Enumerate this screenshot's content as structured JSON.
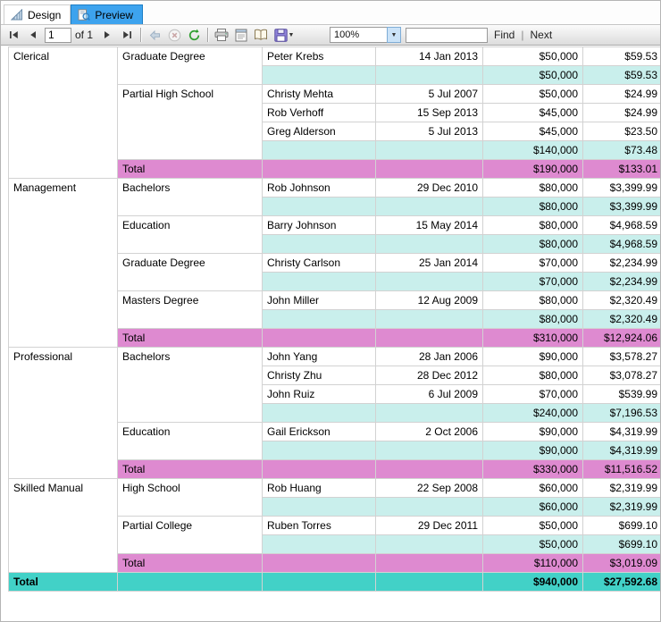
{
  "colors": {
    "active_tab": "#3da3ee",
    "subtotal_row": "#c9efec",
    "total_row": "#de8ad0",
    "grand_total_row": "#42d1c7"
  },
  "icons": {
    "chevron_down": "▼"
  },
  "tabs": {
    "design": {
      "label": "Design"
    },
    "preview": {
      "label": "Preview"
    }
  },
  "toolbar": {
    "page_value": "1",
    "of_label": "of 1",
    "zoom_value": "100%",
    "find_value": "",
    "find_label": "Find",
    "separator": "|",
    "next_label": "Next"
  },
  "report": {
    "columns": [
      "category",
      "education",
      "name",
      "hire_date",
      "salary",
      "sales"
    ],
    "rows": [
      {
        "kind": "detail",
        "cells": [
          {
            "text": "Clerical",
            "rowspan": 7
          },
          {
            "text": "Graduate Degree",
            "rowspan": 2
          },
          {
            "text": "Peter Krebs"
          },
          {
            "text": "14 Jan 2013"
          },
          {
            "text": "$50,000"
          },
          {
            "text": "$59.53"
          }
        ]
      },
      {
        "kind": "subtotal",
        "cells": [
          {
            "text": ""
          },
          {
            "text": ""
          },
          {
            "text": "$50,000"
          },
          {
            "text": "$59.53"
          }
        ]
      },
      {
        "kind": "detail",
        "cells": [
          {
            "text": "Partial High School",
            "rowspan": 4
          },
          {
            "text": "Christy Mehta"
          },
          {
            "text": "5 Jul 2007"
          },
          {
            "text": "$50,000"
          },
          {
            "text": "$24.99"
          }
        ]
      },
      {
        "kind": "detail",
        "cells": [
          {
            "text": "Rob Verhoff"
          },
          {
            "text": "15 Sep 2013"
          },
          {
            "text": "$45,000"
          },
          {
            "text": "$24.99"
          }
        ]
      },
      {
        "kind": "detail",
        "cells": [
          {
            "text": "Greg Alderson"
          },
          {
            "text": "5 Jul 2013"
          },
          {
            "text": "$45,000"
          },
          {
            "text": "$23.50"
          }
        ]
      },
      {
        "kind": "subtotal",
        "cells": [
          {
            "text": ""
          },
          {
            "text": ""
          },
          {
            "text": "$140,000"
          },
          {
            "text": "$73.48"
          }
        ]
      },
      {
        "kind": "total",
        "cells": [
          {
            "text": "Total"
          },
          {
            "text": ""
          },
          {
            "text": ""
          },
          {
            "text": "$190,000"
          },
          {
            "text": "$133.01"
          }
        ]
      },
      {
        "kind": "detail",
        "cells": [
          {
            "text": "Management",
            "rowspan": 9
          },
          {
            "text": "Bachelors",
            "rowspan": 2
          },
          {
            "text": "Rob Johnson"
          },
          {
            "text": "29 Dec 2010"
          },
          {
            "text": "$80,000"
          },
          {
            "text": "$3,399.99"
          }
        ]
      },
      {
        "kind": "subtotal",
        "cells": [
          {
            "text": ""
          },
          {
            "text": ""
          },
          {
            "text": "$80,000"
          },
          {
            "text": "$3,399.99"
          }
        ]
      },
      {
        "kind": "detail",
        "cells": [
          {
            "text": "Education",
            "rowspan": 2
          },
          {
            "text": "Barry Johnson"
          },
          {
            "text": "15 May 2014"
          },
          {
            "text": "$80,000"
          },
          {
            "text": "$4,968.59"
          }
        ]
      },
      {
        "kind": "subtotal",
        "cells": [
          {
            "text": ""
          },
          {
            "text": ""
          },
          {
            "text": "$80,000"
          },
          {
            "text": "$4,968.59"
          }
        ]
      },
      {
        "kind": "detail",
        "cells": [
          {
            "text": "Graduate Degree",
            "rowspan": 2
          },
          {
            "text": "Christy Carlson"
          },
          {
            "text": "25 Jan 2014"
          },
          {
            "text": "$70,000"
          },
          {
            "text": "$2,234.99"
          }
        ]
      },
      {
        "kind": "subtotal",
        "cells": [
          {
            "text": ""
          },
          {
            "text": ""
          },
          {
            "text": "$70,000"
          },
          {
            "text": "$2,234.99"
          }
        ]
      },
      {
        "kind": "detail",
        "cells": [
          {
            "text": "Masters Degree",
            "rowspan": 2
          },
          {
            "text": "John Miller"
          },
          {
            "text": "12 Aug 2009"
          },
          {
            "text": "$80,000"
          },
          {
            "text": "$2,320.49"
          }
        ]
      },
      {
        "kind": "subtotal",
        "cells": [
          {
            "text": ""
          },
          {
            "text": ""
          },
          {
            "text": "$80,000"
          },
          {
            "text": "$2,320.49"
          }
        ]
      },
      {
        "kind": "total",
        "cells": [
          {
            "text": "Total"
          },
          {
            "text": ""
          },
          {
            "text": ""
          },
          {
            "text": "$310,000"
          },
          {
            "text": "$12,924.06"
          }
        ]
      },
      {
        "kind": "detail",
        "cells": [
          {
            "text": "Professional",
            "rowspan": 7
          },
          {
            "text": "Bachelors",
            "rowspan": 4
          },
          {
            "text": "John Yang"
          },
          {
            "text": "28 Jan 2006"
          },
          {
            "text": "$90,000"
          },
          {
            "text": "$3,578.27"
          }
        ]
      },
      {
        "kind": "detail",
        "cells": [
          {
            "text": "Christy Zhu"
          },
          {
            "text": "28 Dec 2012"
          },
          {
            "text": "$80,000"
          },
          {
            "text": "$3,078.27"
          }
        ]
      },
      {
        "kind": "detail",
        "cells": [
          {
            "text": "John Ruiz"
          },
          {
            "text": "6 Jul 2009"
          },
          {
            "text": "$70,000"
          },
          {
            "text": "$539.99"
          }
        ]
      },
      {
        "kind": "subtotal",
        "cells": [
          {
            "text": ""
          },
          {
            "text": ""
          },
          {
            "text": "$240,000"
          },
          {
            "text": "$7,196.53"
          }
        ]
      },
      {
        "kind": "detail",
        "cells": [
          {
            "text": "Education",
            "rowspan": 2
          },
          {
            "text": "Gail Erickson"
          },
          {
            "text": "2 Oct 2006"
          },
          {
            "text": "$90,000"
          },
          {
            "text": "$4,319.99"
          }
        ]
      },
      {
        "kind": "subtotal",
        "cells": [
          {
            "text": ""
          },
          {
            "text": ""
          },
          {
            "text": "$90,000"
          },
          {
            "text": "$4,319.99"
          }
        ]
      },
      {
        "kind": "total",
        "cells": [
          {
            "text": "Total"
          },
          {
            "text": ""
          },
          {
            "text": ""
          },
          {
            "text": "$330,000"
          },
          {
            "text": "$11,516.52"
          }
        ]
      },
      {
        "kind": "detail",
        "cells": [
          {
            "text": "Skilled Manual",
            "rowspan": 5
          },
          {
            "text": "High School",
            "rowspan": 2
          },
          {
            "text": "Rob Huang"
          },
          {
            "text": "22 Sep 2008"
          },
          {
            "text": "$60,000"
          },
          {
            "text": "$2,319.99"
          }
        ]
      },
      {
        "kind": "subtotal",
        "cells": [
          {
            "text": ""
          },
          {
            "text": ""
          },
          {
            "text": "$60,000"
          },
          {
            "text": "$2,319.99"
          }
        ]
      },
      {
        "kind": "detail",
        "cells": [
          {
            "text": "Partial College",
            "rowspan": 2
          },
          {
            "text": "Ruben Torres"
          },
          {
            "text": "29 Dec 2011"
          },
          {
            "text": "$50,000"
          },
          {
            "text": "$699.10"
          }
        ]
      },
      {
        "kind": "subtotal",
        "cells": [
          {
            "text": ""
          },
          {
            "text": ""
          },
          {
            "text": "$50,000"
          },
          {
            "text": "$699.10"
          }
        ]
      },
      {
        "kind": "total",
        "cells": [
          {
            "text": "Total"
          },
          {
            "text": ""
          },
          {
            "text": ""
          },
          {
            "text": "$110,000"
          },
          {
            "text": "$3,019.09"
          }
        ]
      },
      {
        "kind": "grand",
        "cells": [
          {
            "text": "Total"
          },
          {
            "text": ""
          },
          {
            "text": ""
          },
          {
            "text": ""
          },
          {
            "text": "$940,000"
          },
          {
            "text": "$27,592.68"
          }
        ]
      }
    ]
  }
}
